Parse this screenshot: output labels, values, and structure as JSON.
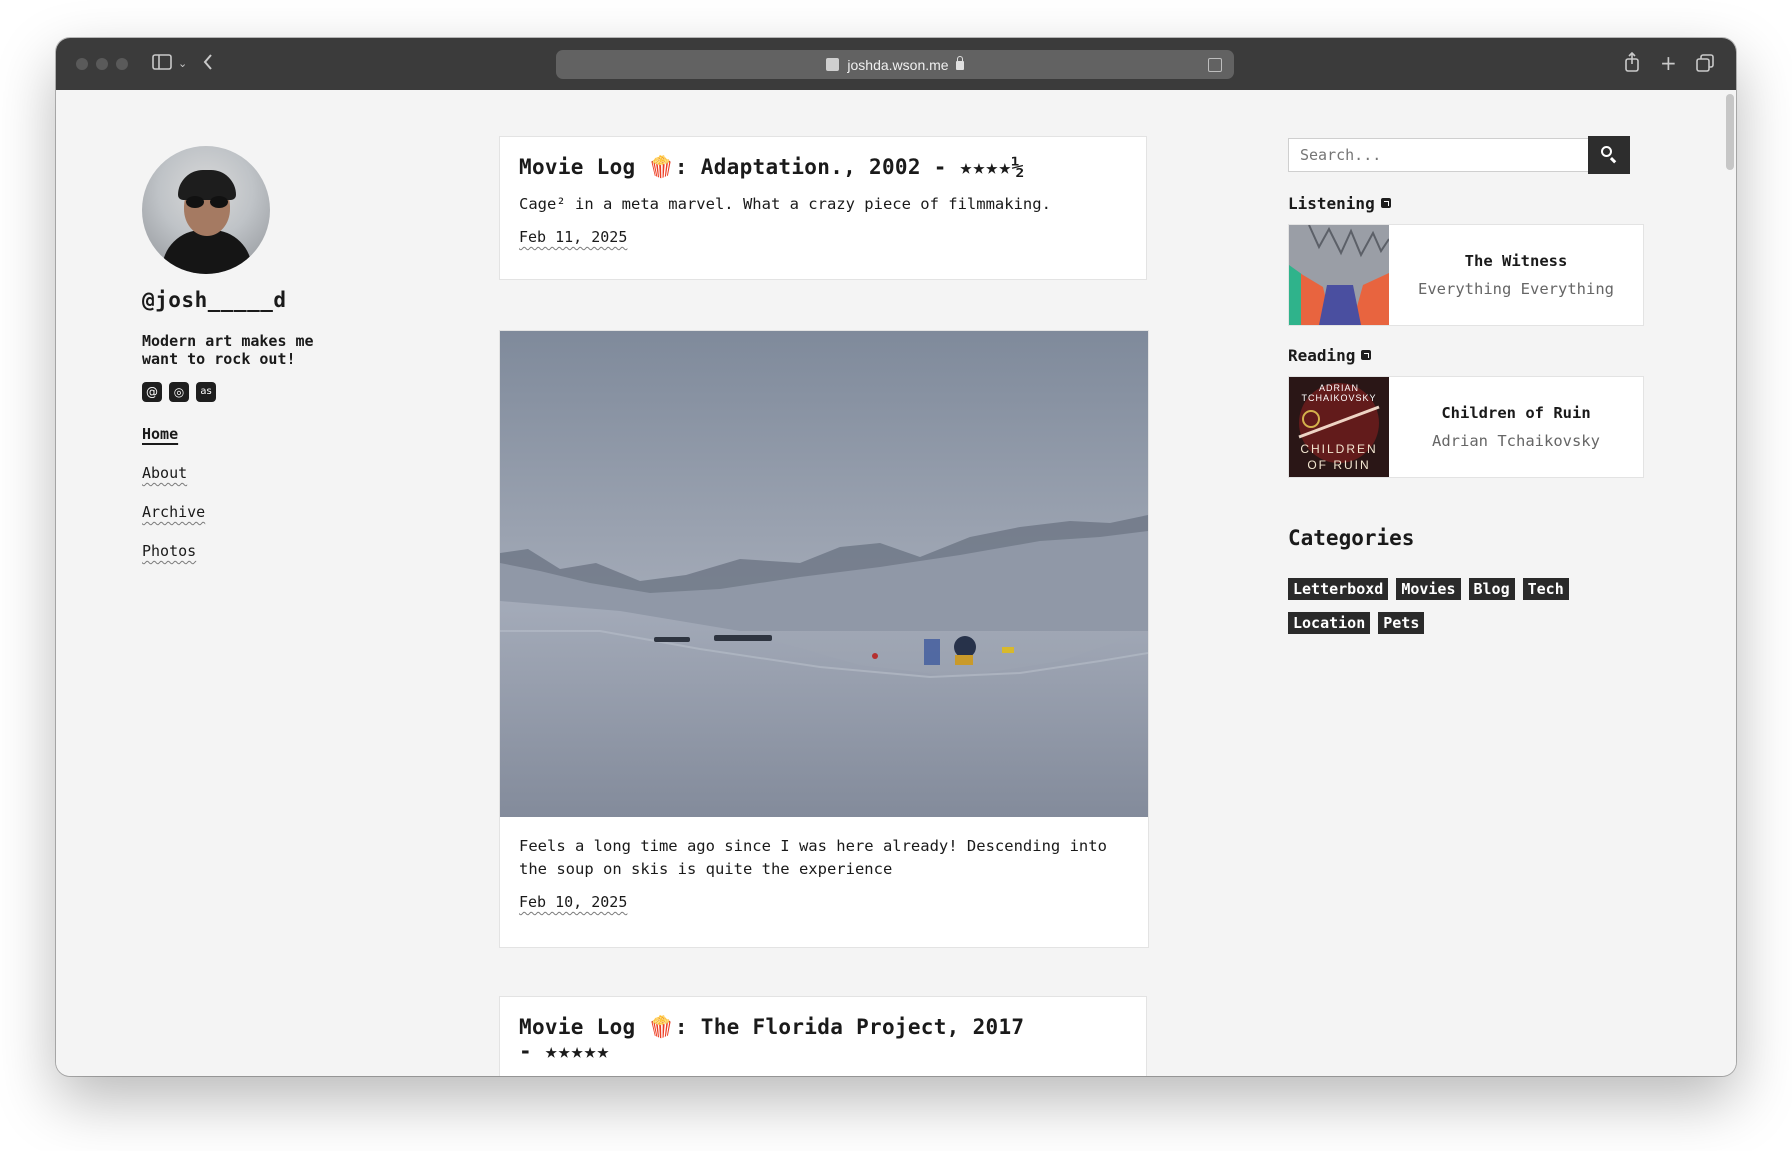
{
  "browser": {
    "url": "joshda.wson.me",
    "colors": {
      "toolbar": "#3b3b3b",
      "urlbar": "#626262"
    }
  },
  "sidebar": {
    "handle": "@josh_____d",
    "bio": "Modern art makes me want to rock out!",
    "socials": [
      {
        "icon": "threads-icon",
        "glyph": "@"
      },
      {
        "icon": "instagram-icon",
        "glyph": "◎"
      },
      {
        "icon": "lastfm-icon",
        "glyph": "as"
      }
    ],
    "nav": [
      {
        "label": "Home",
        "active": true
      },
      {
        "label": "About",
        "active": false
      },
      {
        "label": "Archive",
        "active": false
      },
      {
        "label": "Photos",
        "active": false
      }
    ]
  },
  "posts": [
    {
      "title": "Movie Log 🍿: Adaptation., 2002 - ★★★★½",
      "body": "Cage² in a meta marvel. What a crazy piece of filmmaking.",
      "date": "Feb 11, 2025"
    },
    {
      "image": "snowy-mountain-photo",
      "body": "Feels a long time ago since I was here already! Descending into the soup on skis is quite the experience",
      "date": "Feb 10, 2025"
    },
    {
      "title": "Movie Log 🍿: The Florida Project, 2017 - ★★★★★"
    }
  ],
  "search": {
    "placeholder": "Search..."
  },
  "listening": {
    "label": "Listening",
    "title": "The Witness",
    "artist": "Everything Everything"
  },
  "reading": {
    "label": "Reading",
    "title": "Children of Ruin",
    "author": "Adrian Tchaikovsky",
    "cover_author": "ADRIAN TCHAIKOVSKY",
    "cover_title": "CHILDREN OF RUIN"
  },
  "categories": {
    "heading": "Categories",
    "tags": [
      "Letterboxd",
      "Movies",
      "Blog",
      "Tech",
      "Location",
      "Pets"
    ]
  }
}
